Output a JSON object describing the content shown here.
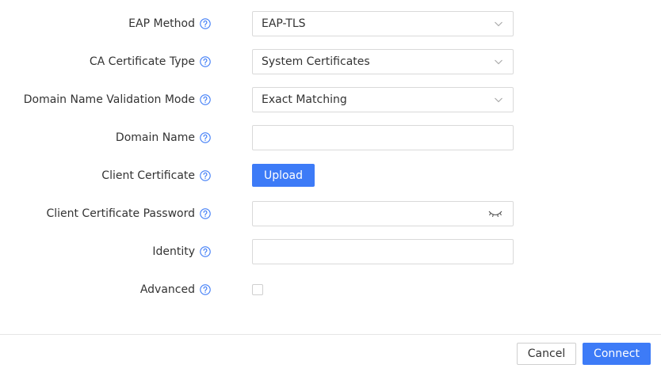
{
  "colors": {
    "accent": "#3d7bf7",
    "help_icon": "#3d7bf7",
    "border": "#d9d9d9",
    "label": "#333333"
  },
  "form": {
    "eap_method": {
      "label": "EAP Method",
      "help_icon": "help-circle-icon",
      "value": "EAP-TLS",
      "control_icon": "chevron-down-icon"
    },
    "ca_certificate_type": {
      "label": "CA Certificate Type",
      "help_icon": "help-circle-icon",
      "value": "System Certificates",
      "control_icon": "chevron-down-icon"
    },
    "domain_name_validation_mode": {
      "label": "Domain Name Validation Mode",
      "help_icon": "help-circle-icon",
      "value": "Exact Matching",
      "control_icon": "chevron-down-icon"
    },
    "domain_name": {
      "label": "Domain Name",
      "help_icon": "help-circle-icon",
      "value": ""
    },
    "client_certificate": {
      "label": "Client Certificate",
      "help_icon": "help-circle-icon",
      "button_label": "Upload"
    },
    "client_certificate_password": {
      "label": "Client Certificate Password",
      "help_icon": "help-circle-icon",
      "value": "",
      "toggle_icon": "eye-closed-icon"
    },
    "identity": {
      "label": "Identity",
      "help_icon": "help-circle-icon",
      "value": ""
    },
    "advanced": {
      "label": "Advanced",
      "help_icon": "help-circle-icon",
      "checked": false
    }
  },
  "footer": {
    "cancel_label": "Cancel",
    "connect_label": "Connect"
  }
}
